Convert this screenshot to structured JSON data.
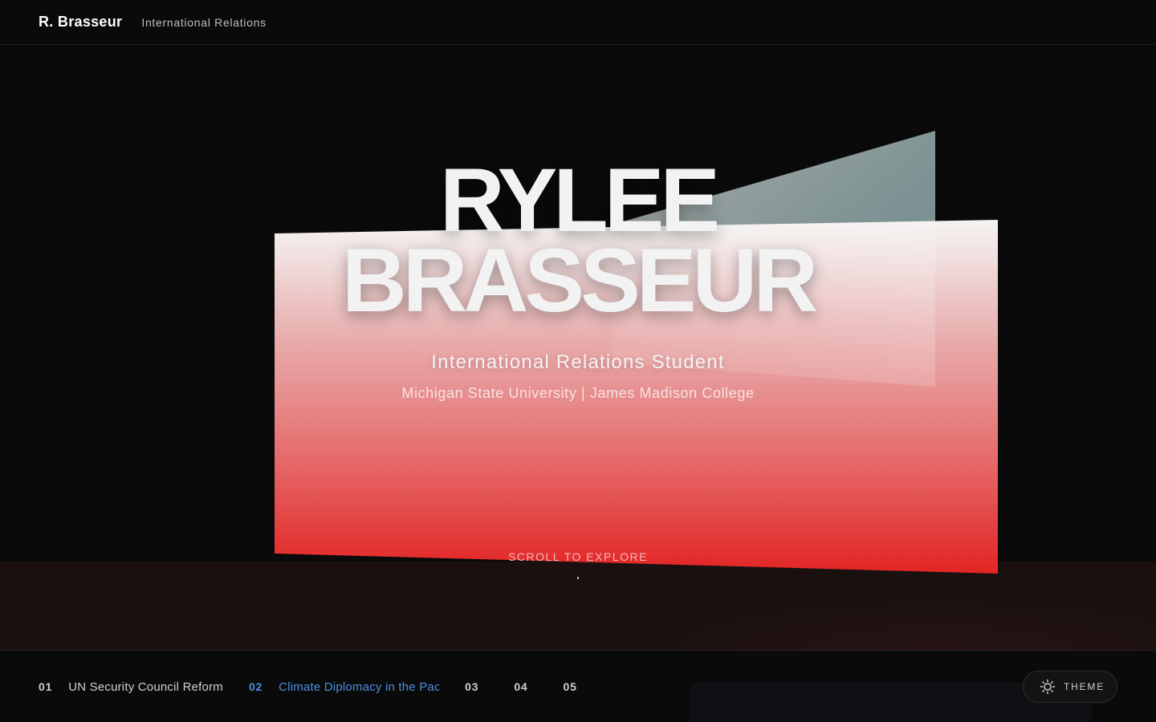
{
  "header": {
    "brand": "R. Brasseur",
    "subtitle": "International Relations"
  },
  "hero": {
    "name_line1": "RYLEE",
    "name_line2": "BRASSEUR",
    "role": "International Relations Student",
    "school": "Michigan State University | James Madison College",
    "scroll_hint": "SCROLL TO EXPLORE"
  },
  "projects": [
    {
      "num": "01",
      "title": "UN Security Council Reform",
      "active": false
    },
    {
      "num": "02",
      "title": "Climate Diplomacy in the Pacific",
      "active": true
    },
    {
      "num": "03",
      "title": "",
      "active": false
    },
    {
      "num": "04",
      "title": "",
      "active": false
    },
    {
      "num": "05",
      "title": "",
      "active": false
    }
  ],
  "theme_button": {
    "label": "THEME",
    "icon": "sun-icon"
  },
  "colors": {
    "background": "#0a0a0a",
    "accent_blue": "#4a8fe0",
    "panel_red": "#e32424",
    "panel_light": "#f2f2f2"
  }
}
